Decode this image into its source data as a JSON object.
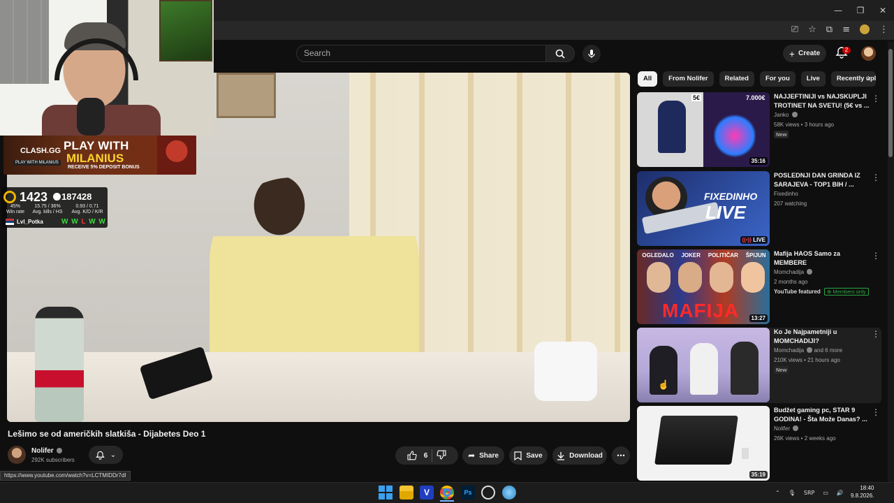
{
  "window": {
    "minimize": "—",
    "restore": "❐",
    "close": "✕"
  },
  "header": {
    "search_placeholder": "Search",
    "create_label": "Create",
    "notifications_count": "2"
  },
  "overlay": {
    "clash_label": "CLASH.GG",
    "play_with": "PLAY WITH",
    "streamer": "MILANIUS",
    "tag": "PLAY WITH MILANIUS",
    "bonus": "RECEIVE 5% DEPOSIT BONUS",
    "elo": "1423",
    "points": "187428",
    "winrate": "45%",
    "winrate_label": "Win rate",
    "kills": "15.75 / 36%",
    "kills_label": "Avg. kills / HS",
    "kd": "0.93 / 0.71",
    "kd_label": "Avg. K/D / K/R",
    "user": "Lvl_Potka",
    "results": [
      "W",
      "W",
      "L",
      "W",
      "W"
    ]
  },
  "video": {
    "title": "Lešimo se od američkih slatkiša - Dijabetes Deo 1",
    "channel": "Nolifer",
    "subscribers": "292K subscribers",
    "likes": "6",
    "share_label": "Share",
    "save_label": "Save",
    "download_label": "Download"
  },
  "status_url": "https://www.youtube.com/watch?v=LCTMIDDr7dI",
  "chips": [
    "All",
    "From Nolifer",
    "Related",
    "For you",
    "Live",
    "Recently upl"
  ],
  "recommendations": [
    {
      "title": "NAJJEFTINIJI vs NAJSKUPLJI TROTINET NA SVETU! (5€ vs ...",
      "channel": "Janko",
      "meta": "58K views • 3 hours ago",
      "badge": "New",
      "duration": "35:16",
      "thumb_left_label": "5€",
      "thumb_right_label": "7.000€"
    },
    {
      "title": "POSLEDNJI DAN GRINDA IZ SARAJEVA - TOP1 BIH / ...",
      "channel": "Fixedinho",
      "meta": "207 watching",
      "live": "LIVE",
      "thumb_line1": "FIXEDINHO",
      "thumb_line2": "LIVE"
    },
    {
      "title": "Mafija HAOS Samo za MEMBERE",
      "channel": "Momchadija",
      "meta": "2 months ago",
      "featured": "YouTube featured",
      "members": "Members only",
      "duration": "13:27",
      "thumb_labels": [
        "OGLEDALO",
        "JOKER",
        "POLITIČAR",
        "ŠPIJUN"
      ],
      "thumb_big": "MAFIJA"
    },
    {
      "title": "Ko Je Najpametniji u MOMCHADIJI?",
      "channel": "Momchadija",
      "channel_extra": "and 6 more",
      "meta": "210K views • 21 hours ago",
      "badge": "New"
    },
    {
      "title": "Budžet gaming pc, STAR 9 GODINA! - Šta Može Danas? ...",
      "channel": "Nolifer",
      "meta": "26K views • 2 weeks ago",
      "duration": "35:19"
    }
  ],
  "tray": {
    "lang": "SRP",
    "time": "18:40",
    "date": "9.8.2026."
  },
  "colors": {
    "accent": "#cc0000",
    "live": "#cc0000",
    "members": "#2ba640"
  }
}
